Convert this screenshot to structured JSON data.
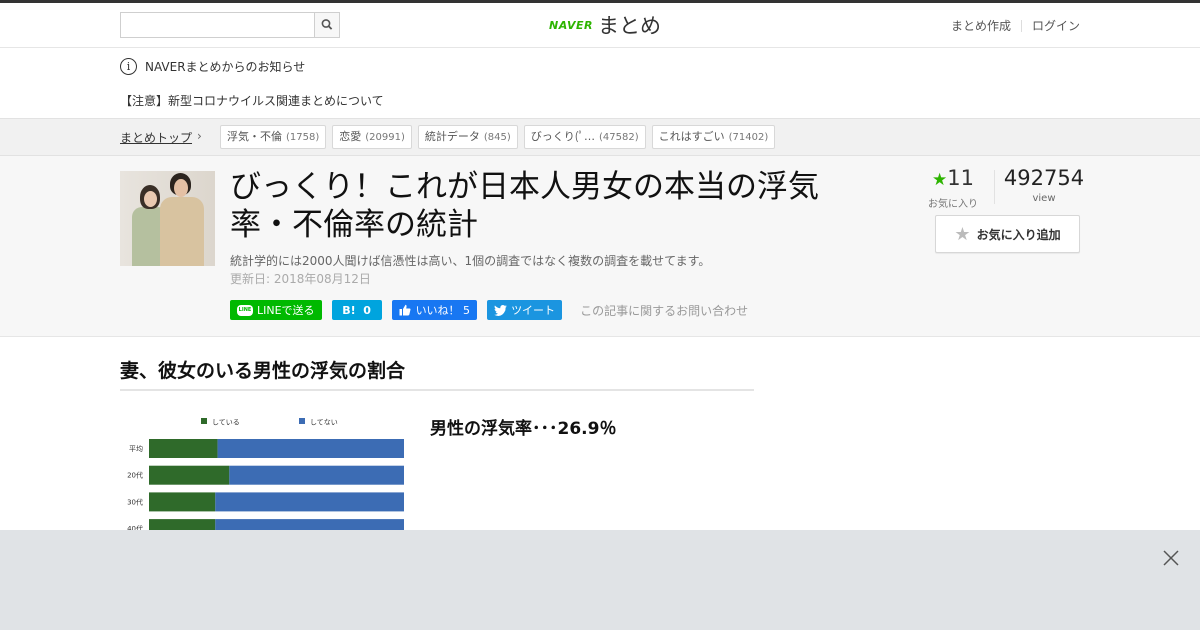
{
  "header": {
    "search_placeholder": "",
    "logo_brand": "NAVER",
    "logo_text": "まとめ",
    "links": [
      "まとめ作成",
      "ログイン"
    ]
  },
  "notices": {
    "info": "NAVERまとめからのお知らせ",
    "corona": "【注意】新型コロナウイルス関連まとめについて"
  },
  "breadcrumb": {
    "top": "まとめトップ",
    "tags": [
      {
        "label": "浮気・不倫",
        "count": "(1758)"
      },
      {
        "label": "恋愛",
        "count": "(20991)"
      },
      {
        "label": "統計データ",
        "count": "(845)"
      },
      {
        "label": "びっくり(ﾟ…",
        "count": "(47582)"
      },
      {
        "label": "これはすごい",
        "count": "(71402)"
      }
    ]
  },
  "article": {
    "title": "びっくり！これが日本人男女の本当の浮気率・不倫率の統計",
    "description": "統計学的には2000人聞けば信憑性は高い、1個の調査ではなく複数の調査を載せてます。",
    "updated": "更新日: 2018年08月12日",
    "favorites": "11",
    "favorites_label": "お気に入り",
    "views": "492754",
    "views_label": "view",
    "add_fav_label": "お気に入り追加",
    "share": {
      "line": "LINEで送る",
      "line_badge": "LINE",
      "hatena_mark": "B!",
      "hatena_count": "0",
      "fb": "いいね！ 5",
      "tw": "ツイート",
      "contact": "この記事に関するお問い合わせ"
    }
  },
  "section": {
    "heading": "妻、彼女のいる男性の浮気の割合",
    "caption": "男性の浮気率･･･26.9％"
  },
  "chart_data": {
    "type": "bar",
    "stacked": true,
    "orientation": "horizontal",
    "categories": [
      "平均",
      "20代",
      "30代",
      "40代"
    ],
    "series": [
      {
        "name": "している",
        "color": "#2f6a2a",
        "values": [
          26.9,
          31.5,
          26,
          26
        ]
      },
      {
        "name": "してない",
        "color": "#3c6cb4",
        "values": [
          73.1,
          68.5,
          74,
          74
        ]
      }
    ],
    "xlim": [
      0,
      100
    ],
    "legend": "top"
  },
  "colors": {
    "naver_green": "#2db400",
    "ad_bg": "#e0e3e6"
  }
}
